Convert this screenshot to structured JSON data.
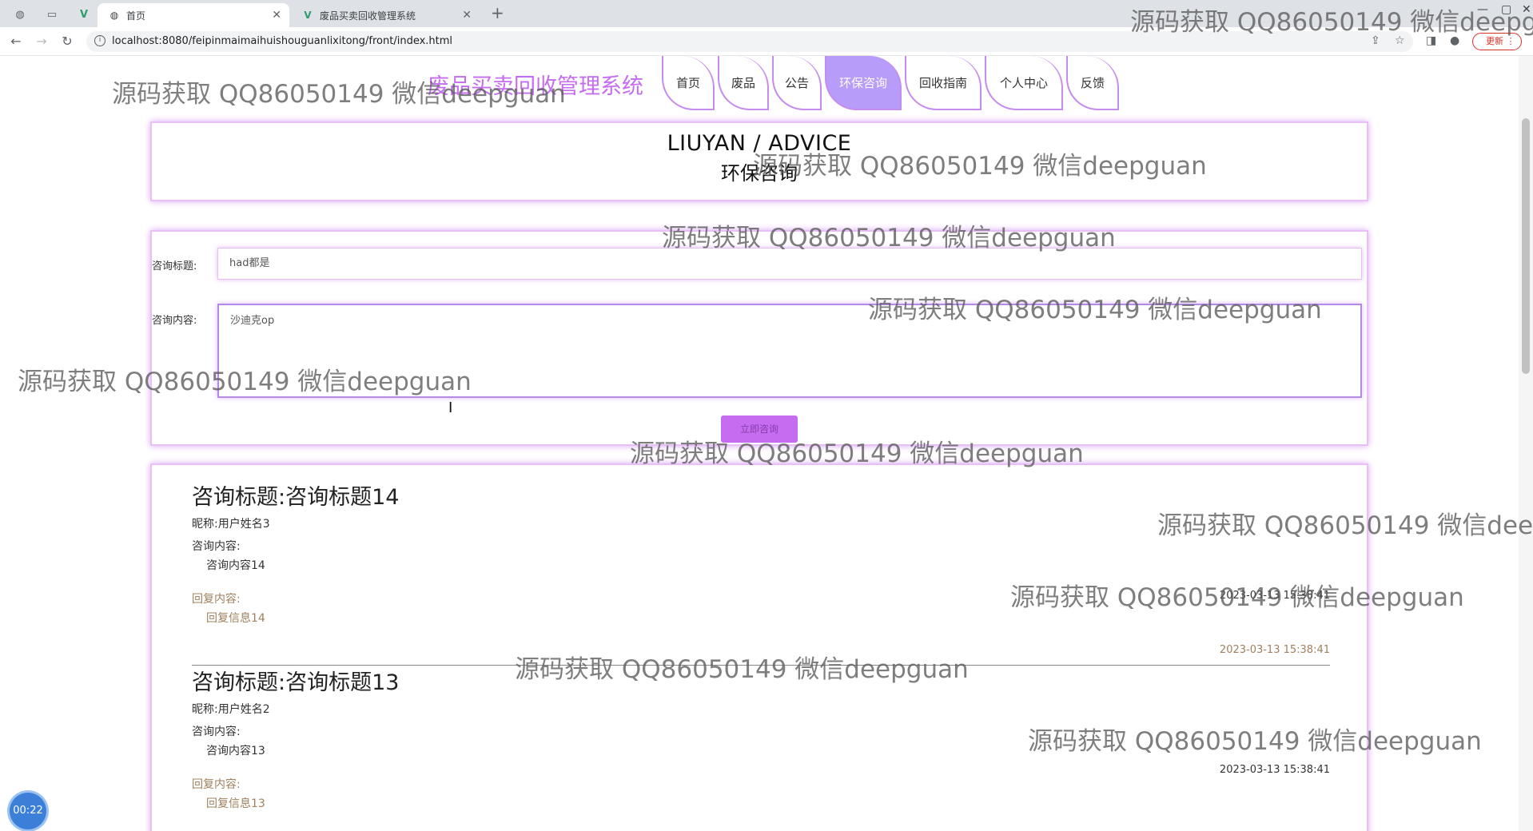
{
  "browser": {
    "tabs": [
      {
        "label": "首页",
        "icon": "globe-icon",
        "active": true
      },
      {
        "label": "废品买卖回收管理系统",
        "icon": "vue-logo-icon",
        "active": false
      }
    ],
    "url": "localhost:8080/feipinmaimaihuishouguanlixitong/front/index.html",
    "update_label": "更新"
  },
  "site": {
    "title": "废品买卖回收管理系统",
    "nav": [
      {
        "label": "首页",
        "active": false
      },
      {
        "label": "废品",
        "active": false
      },
      {
        "label": "公告",
        "active": false
      },
      {
        "label": "环保咨询",
        "active": true
      },
      {
        "label": "回收指南",
        "active": false
      },
      {
        "label": "个人中心",
        "active": false
      },
      {
        "label": "反馈",
        "active": false
      }
    ]
  },
  "banner": {
    "en": "LIUYAN / ADVICE",
    "cn": "环保咨询"
  },
  "form": {
    "title_label": "咨询标题:",
    "title_value": "had都是",
    "content_label": "咨询内容:",
    "content_value": "沙迪克op",
    "submit_label": "立即咨询"
  },
  "entries": [
    {
      "title": "咨询标题:咨询标题14",
      "nickname": "昵称:用户姓名3",
      "content_label": "咨询内容:",
      "content": "咨询内容14",
      "date": "2023-03-13 15:38:41",
      "reply_label": "回复内容:",
      "reply": "回复信息14",
      "reply_date": "2023-03-13 15:38:41"
    },
    {
      "title": "咨询标题:咨询标题13",
      "nickname": "昵称:用户姓名2",
      "content_label": "咨询内容:",
      "content": "咨询内容13",
      "date": "2023-03-13 15:38:41",
      "reply_label": "回复内容:",
      "reply": "回复信息13"
    }
  ],
  "watermark_text": "源码获取 QQ86050149 微信deepguan",
  "timer": "00:22",
  "colors": {
    "accent": "#c56cf0",
    "nav_active": "#b79cfa",
    "reply": "#a08060"
  }
}
